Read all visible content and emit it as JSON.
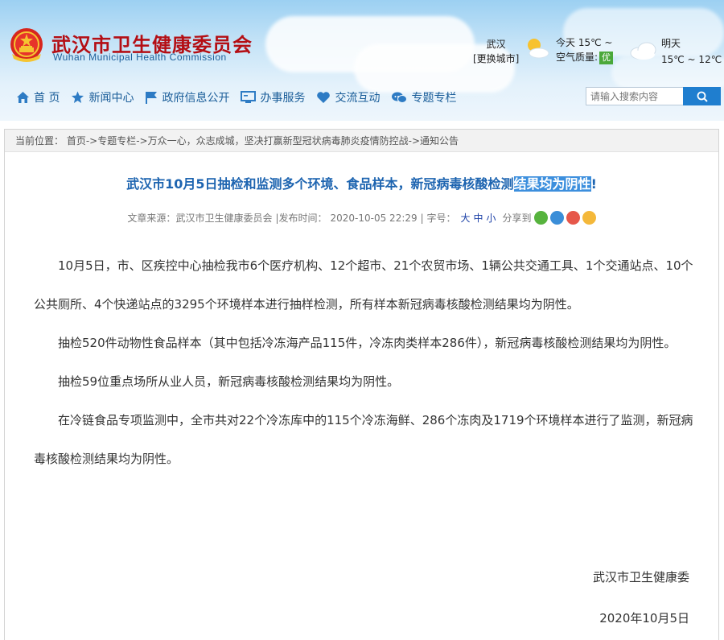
{
  "header": {
    "site_title": "武汉市卫生健康委员会",
    "site_subtitle": "Wuhan Municipal Health Commission",
    "weather": {
      "city": "武汉",
      "change_city": "[更换城市]",
      "today_label": "今天",
      "today_temp": "15℃ ~",
      "air_quality_label": "空气质量:",
      "air_quality_value": "优",
      "tomorrow_label": "明天",
      "tomorrow_temp": "15℃ ~ 12℃",
      "aqi_color": "#4aa83a"
    },
    "nav": [
      {
        "label": "首 页",
        "icon": "home-icon"
      },
      {
        "label": "新闻中心",
        "icon": "star-icon"
      },
      {
        "label": "政府信息公开",
        "icon": "flag-icon"
      },
      {
        "label": "办事服务",
        "icon": "monitor-icon"
      },
      {
        "label": "交流互动",
        "icon": "heart-icon"
      },
      {
        "label": "专题专栏",
        "icon": "chat-icon"
      }
    ],
    "search_placeholder": "请输入搜索内容"
  },
  "breadcrumb": {
    "label": "当前位置：",
    "path": "首页->专题专栏->万众一心，众志成城，坚决打赢新型冠状病毒肺炎疫情防控战->通知公告"
  },
  "article": {
    "title_main": "武汉市10月5日抽检和监测多个环境、食品样本，新冠病毒核酸检测",
    "title_highlight": "结果均为阴性",
    "title_end": "!",
    "meta": {
      "source_label": "文章来源：",
      "source": "武汉市卫生健康委员会",
      "date_label": "|发布时间：",
      "date": "2020-10-05 22:29",
      "fontsize_label": "| 字号：",
      "size_large": "大",
      "size_medium": "中",
      "size_small": "小",
      "share_label": "分享到"
    },
    "paragraphs": [
      "10月5日，市、区疾控中心抽检我市6个医疗机构、12个超市、21个农贸市场、1辆公共交通工具、1个交通站点、10个公共厕所、4个快递站点的3295个环境样本进行抽样检测，所有样本新冠病毒核酸检测结果均为阴性。",
      "抽检520件动物性食品样本（其中包括冷冻海产品115件，冷冻肉类样本286件），新冠病毒核酸检测结果均为阴性。",
      "抽检59位重点场所从业人员，新冠病毒核酸检测结果均为阴性。",
      "在冷链食品专项监测中，全市共对22个冷冻库中的115个冷冻海鲜、286个冻肉及1719个环境样本进行了监测，新冠病毒核酸检测结果均为阴性。"
    ],
    "signature_org": "武汉市卫生健康委",
    "signature_date": "2020年10月5日"
  },
  "colors": {
    "title_red": "#b40e14",
    "nav_blue": "#1a5d99",
    "article_title_blue": "#1d64b0",
    "highlight_bg": "#3c8fdd",
    "search_button": "#1f7ecf"
  }
}
